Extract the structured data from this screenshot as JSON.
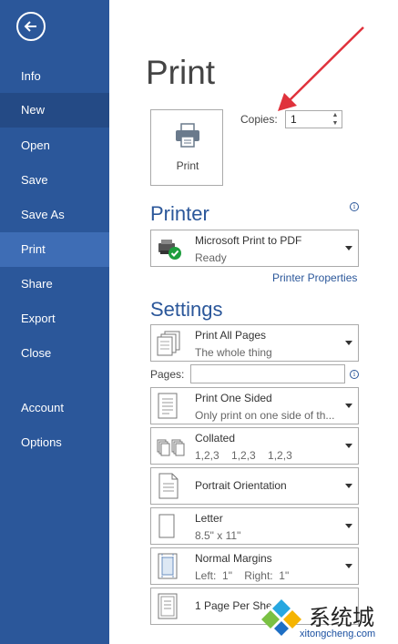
{
  "sidebar": {
    "items": [
      {
        "label": "Info"
      },
      {
        "label": "New"
      },
      {
        "label": "Open"
      },
      {
        "label": "Save"
      },
      {
        "label": "Save As"
      },
      {
        "label": "Print"
      },
      {
        "label": "Share"
      },
      {
        "label": "Export"
      },
      {
        "label": "Close"
      },
      {
        "label": "Account"
      },
      {
        "label": "Options"
      }
    ],
    "active": "Print"
  },
  "main": {
    "title": "Print",
    "print_button": "Print",
    "copies_label": "Copies:",
    "copies_value": "1"
  },
  "printer": {
    "heading": "Printer",
    "name": "Microsoft Print to PDF",
    "status": "Ready",
    "properties_link": "Printer Properties"
  },
  "settings": {
    "heading": "Settings",
    "pages_label": "Pages:",
    "pages_value": "",
    "options": [
      {
        "main": "Print All Pages",
        "sub": "The whole thing"
      },
      {
        "main": "Print One Sided",
        "sub": "Only print on one side of th..."
      },
      {
        "main": "Collated",
        "sub": "1,2,3    1,2,3    1,2,3"
      },
      {
        "main": "Portrait Orientation",
        "sub": ""
      },
      {
        "main": "Letter",
        "sub": "8.5\" x 11\""
      },
      {
        "main": "Normal Margins",
        "sub": "Left:  1\"    Right:  1\""
      },
      {
        "main": "1 Page Per Sheet",
        "sub": ""
      }
    ]
  },
  "watermark": {
    "text": "系统城",
    "sub": "xitongcheng.com"
  },
  "colors": {
    "sidebar": "#2b579a",
    "accent": "#2b579a",
    "arrow": "#e0323c"
  }
}
